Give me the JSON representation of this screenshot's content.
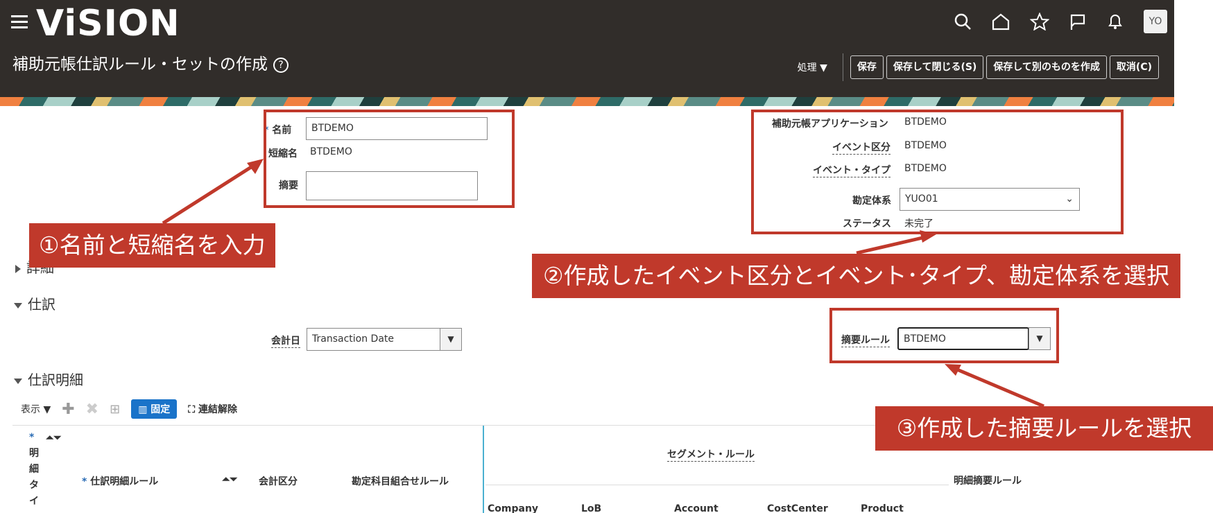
{
  "header": {
    "logo": "ViSION",
    "page_title": "補助元帳仕訳ルール・セットの作成",
    "help_glyph": "?",
    "avatar": "YO",
    "menu_shori": "処理",
    "buttons": {
      "save": "保存",
      "save_close": "保存して閉じる(S)",
      "save_create": "保存して別のものを作成",
      "cancel": "取消(C)"
    },
    "icons": [
      "search-icon",
      "home-icon",
      "star-icon",
      "flag-icon",
      "bell-icon"
    ]
  },
  "form_left": {
    "name_label": "名前",
    "name_value": "BTDEMO",
    "short_label": "短縮名",
    "short_value": "BTDEMO",
    "desc_label": "摘要",
    "desc_value": ""
  },
  "form_right": {
    "app_label": "補助元帳アプリケーション",
    "app_value": "BTDEMO",
    "event_class_label": "イベント区分",
    "event_class_value": "BTDEMO",
    "event_type_label": "イベント・タイプ",
    "event_type_value": "BTDEMO",
    "coa_label": "勘定体系",
    "coa_value": "YUO01",
    "status_label": "ステータス",
    "status_value": "未完了"
  },
  "sections": {
    "details": "詳細",
    "journal": "仕訳",
    "journal_lines": "仕訳明細"
  },
  "journal": {
    "acct_date_label": "会計日",
    "acct_date_value": "Transaction Date",
    "desc_rule_label": "摘要ルール",
    "desc_rule_value": "BTDEMO"
  },
  "toolbar": {
    "view": "表示",
    "freeze": "固定",
    "detach": "連結解除"
  },
  "grid": {
    "line_type": [
      "明",
      "細",
      "タ",
      "イ"
    ],
    "line_rule": "仕訳明細ルール",
    "acct_class": "会計区分",
    "acct_combo_rule": "勘定科目組合せルール",
    "segment_rule": "セグメント・ルール",
    "line_desc_rule": "明細摘要ルール",
    "segments": [
      "Company",
      "LoB",
      "Account",
      "CostCenter",
      "Product"
    ]
  },
  "callouts": {
    "c1": "①名前と短縮名を入力",
    "c2": "②作成したイベント区分とイベント･タイプ、勘定体系を選択",
    "c3": "③作成した摘要ルールを選択"
  },
  "colors": {
    "header_bg": "#312d2a",
    "callout_red": "#c0392b",
    "freeze_blue": "#1a73c9"
  }
}
